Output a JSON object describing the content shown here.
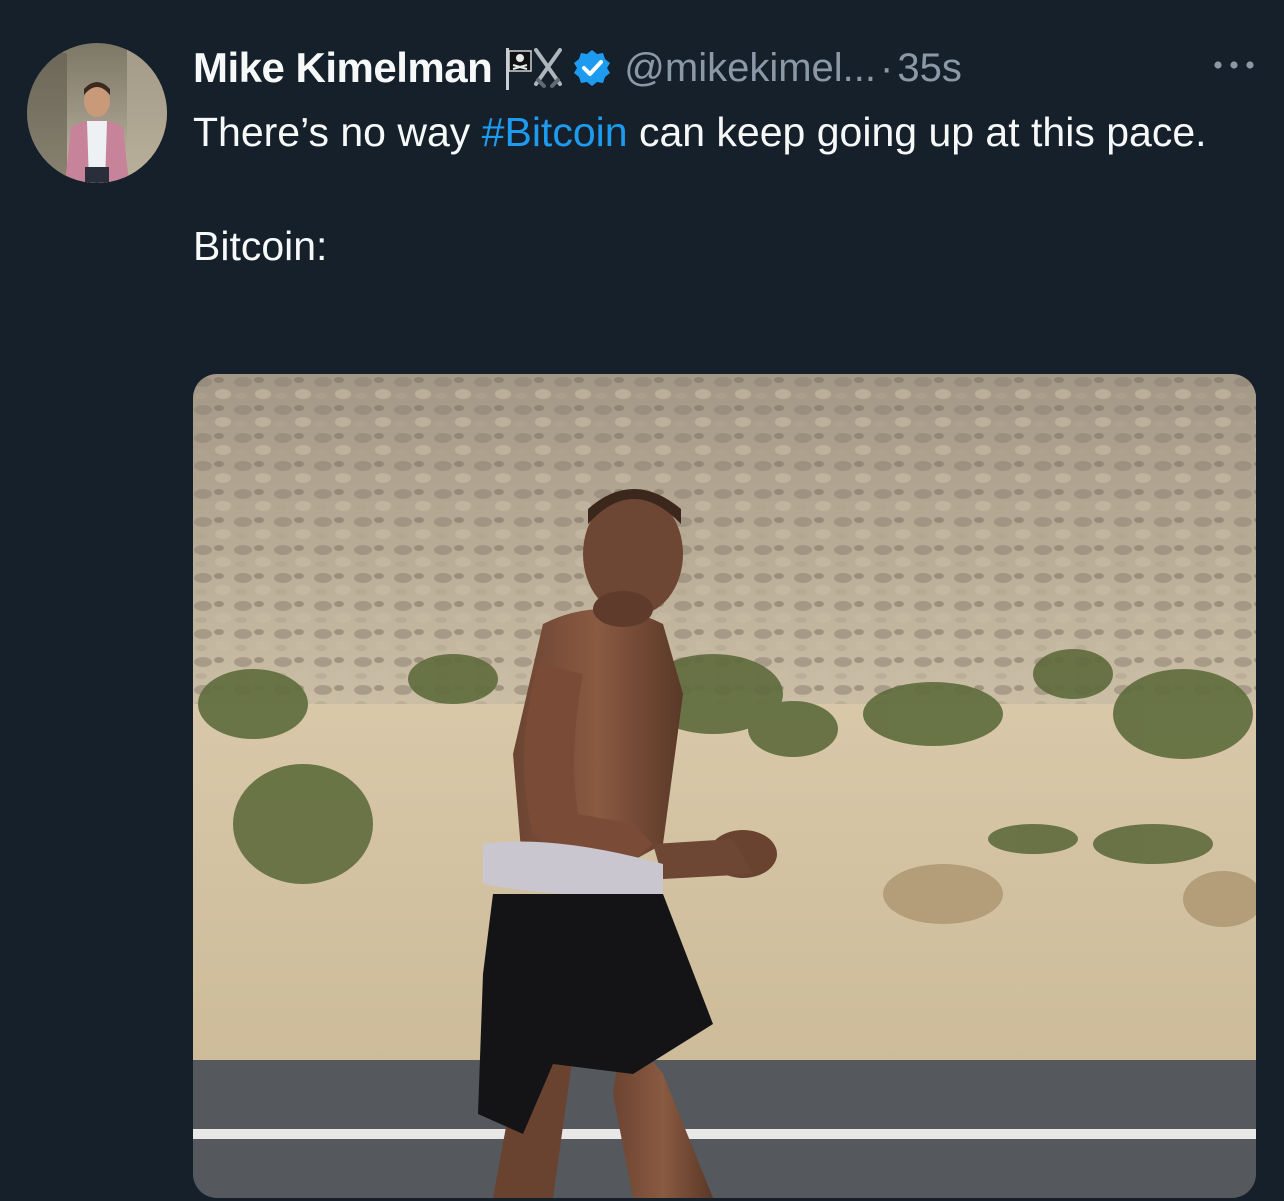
{
  "tweet": {
    "author": {
      "display_name": "Mike Kimelman",
      "handle": "@mikekimel...",
      "name_emojis": [
        "pirate-flag-icon",
        "crossed-swords-icon"
      ],
      "verified": true
    },
    "separator": "·",
    "timestamp": "35s",
    "text": {
      "line1_before": "There’s no way ",
      "hashtag": "#Bitcoin",
      "line1_after": " can keep going up at this pace.",
      "line2": "Bitcoin:"
    },
    "media": {
      "kind": "photo",
      "alt_subject": "runner-on-desert-road"
    }
  },
  "colors": {
    "background": "#15202b",
    "primary_text": "#f7f9f9",
    "secondary_text": "#8b98a5",
    "accent": "#1d9bf0"
  }
}
